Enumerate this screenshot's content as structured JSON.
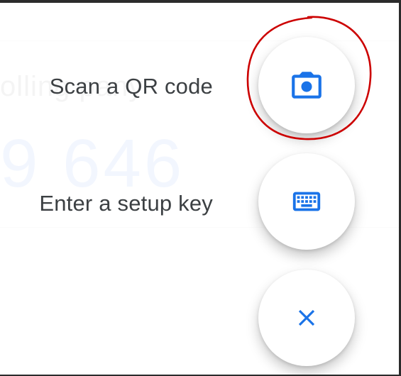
{
  "background": {
    "account_text": "olling pany",
    "code_text": "9 646"
  },
  "actions": [
    {
      "label": "Scan a QR code",
      "icon": "camera-icon"
    },
    {
      "label": "Enter a setup key",
      "icon": "keyboard-icon"
    }
  ],
  "close": {
    "icon": "close-icon"
  },
  "annotation": {
    "color": "#cc0000",
    "target": "Scan a QR code"
  },
  "colors": {
    "accent": "#1a73e8",
    "label": "#3c4043",
    "surface": "#ffffff"
  }
}
